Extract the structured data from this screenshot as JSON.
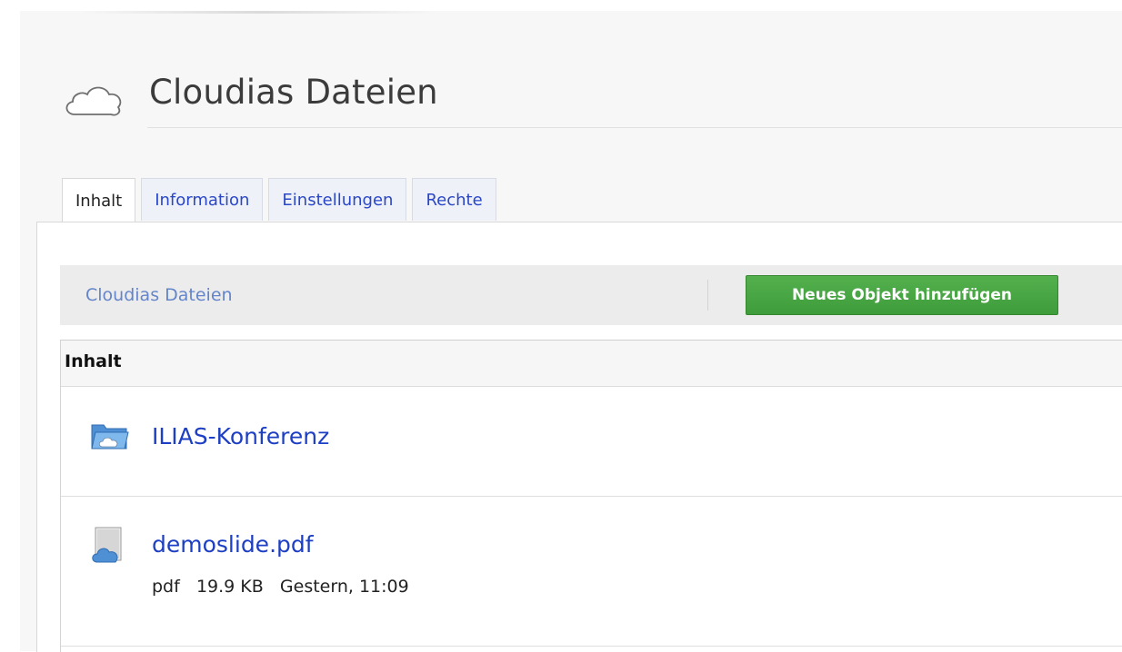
{
  "page": {
    "title": "Cloudias Dateien"
  },
  "tabs": [
    {
      "label": "Inhalt",
      "active": true
    },
    {
      "label": "Information",
      "active": false
    },
    {
      "label": "Einstellungen",
      "active": false
    },
    {
      "label": "Rechte",
      "active": false
    }
  ],
  "toolbar": {
    "breadcrumb": "Cloudias Dateien",
    "add_button_label": "Neues Objekt hinzufügen"
  },
  "list": {
    "header": "Inhalt",
    "items": [
      {
        "icon": "cloud-folder-icon",
        "name": "ILIAS-Konferenz"
      },
      {
        "icon": "cloud-file-icon",
        "name": "demoslide.pdf",
        "type": "pdf",
        "size": "19.9 KB",
        "date": "Gestern, 11:09"
      }
    ]
  },
  "colors": {
    "link": "#1d3fc4",
    "crumb": "#6485c9",
    "button": "#46a541",
    "tab_text": "#2a47c8"
  }
}
